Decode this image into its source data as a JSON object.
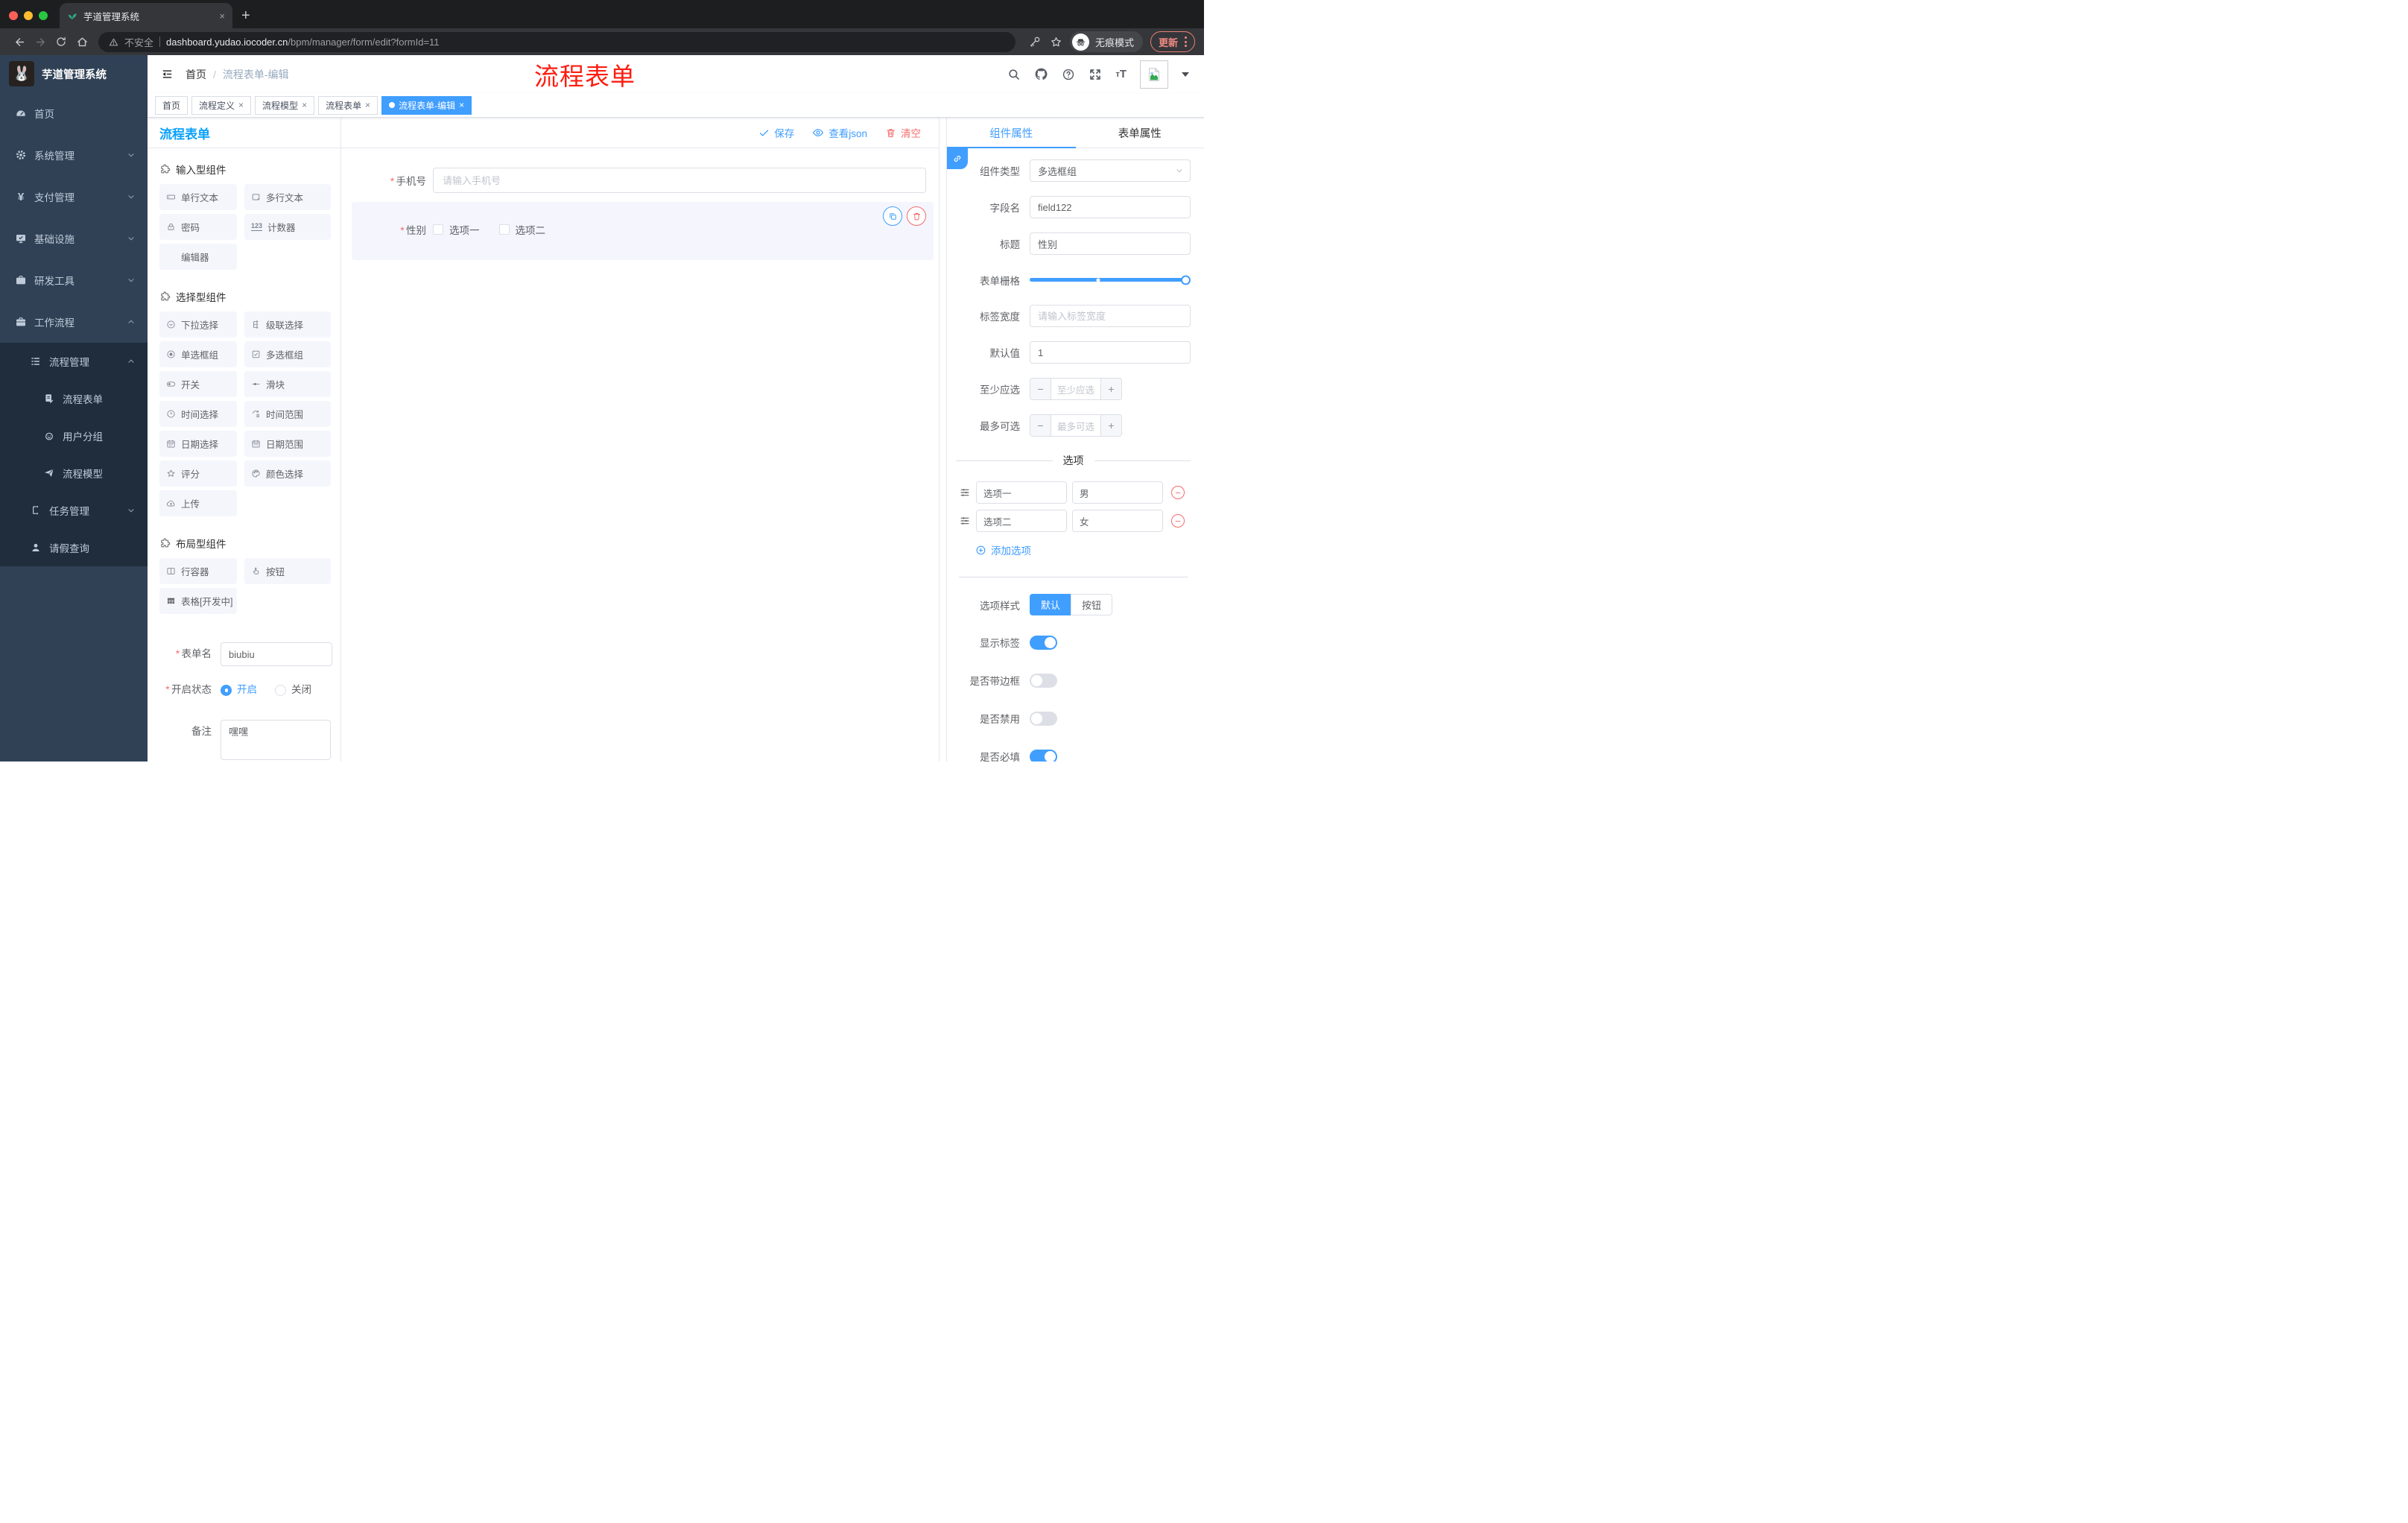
{
  "glyphs": {
    "close": "×",
    "plus": "+",
    "minus": "−",
    "yen": "¥",
    "required": "*",
    "font_size": "tT",
    "counter": "123"
  },
  "colors": {
    "accent": "#409eff",
    "danger": "#f56c6c",
    "panel_title_blue": "#0aa1fb",
    "annotation_red": "#fe1c10",
    "sidebar_bg": "#304156",
    "sidebar_sub_bg": "#1f2d3d",
    "chip_bg": "#f4f6fc",
    "selected_widget_bg": "#f4f5fd"
  },
  "browser": {
    "tab_title": "芋道管理系统",
    "security_label": "不安全",
    "url_domain": "dashboard.yudao.iocoder.cn",
    "url_path": "/bpm/manager/form/edit?formId=11",
    "incognito_label": "无痕模式",
    "update_label": "更新"
  },
  "header": {
    "breadcrumb_home": "首页",
    "breadcrumb_separator": "/",
    "breadcrumb_current": "流程表单-编辑",
    "annotation": "流程表单"
  },
  "sidebar": {
    "logo_title": "芋道管理系统",
    "items": {
      "home": "首页",
      "system": "系统管理",
      "payment": "支付管理",
      "infra": "基础设施",
      "dev": "研发工具",
      "workflow": "工作流程",
      "process_mgmt": "流程管理",
      "process_form": "流程表单",
      "user_group": "用户分组",
      "process_model": "流程模型",
      "task_mgmt": "任务管理",
      "leave_query": "请假查询"
    }
  },
  "tags": {
    "t0": "首页",
    "t1": "流程定义",
    "t2": "流程模型",
    "t3": "流程表单",
    "t4": "流程表单-编辑"
  },
  "left_panel": {
    "title": "流程表单",
    "sec_input": "输入型组件",
    "sec_select": "选择型组件",
    "sec_layout": "布局型组件",
    "items": {
      "single_text": "单行文本",
      "multi_text": "多行文本",
      "password": "密码",
      "counter": "计数器",
      "editor": "编辑器",
      "select": "下拉选择",
      "cascader": "级联选择",
      "radio_group": "单选框组",
      "checkbox_group": "多选框组",
      "switch": "开关",
      "slider": "滑块",
      "time": "时间选择",
      "time_range": "时间范围",
      "date": "日期选择",
      "date_range": "日期范围",
      "rate": "评分",
      "color": "颜色选择",
      "upload": "上传",
      "row": "行容器",
      "button": "按钮",
      "table": "表格[开发中]"
    },
    "form": {
      "name_label": "表单名",
      "name_value": "biubiu",
      "status_label": "开启状态",
      "status_on": "开启",
      "status_off": "关闭",
      "remark_label": "备注",
      "remark_value": "嘿嘿"
    }
  },
  "canvas": {
    "save": "保存",
    "view_json": "查看json",
    "clear": "清空",
    "phone": {
      "label": "手机号",
      "placeholder": "请输入手机号"
    },
    "gender": {
      "label": "性别",
      "opt1": "选项一",
      "opt2": "选项二"
    }
  },
  "right_panel": {
    "tab_component": "组件属性",
    "tab_form": "表单属性",
    "component_type_label": "组件类型",
    "component_type_value": "多选框组",
    "field_name_label": "字段名",
    "field_name_value": "field122",
    "title_label": "标题",
    "title_value": "性别",
    "grid_label": "表单栅格",
    "label_width_label": "标签宽度",
    "label_width_placeholder": "请输入标签宽度",
    "default_label": "默认值",
    "default_value": "1",
    "min_label": "至少应选",
    "min_placeholder": "至少应选",
    "max_label": "最多可选",
    "max_placeholder": "最多可选",
    "options_title": "选项",
    "options": [
      {
        "label": "选项一",
        "value": "男"
      },
      {
        "label": "选项二",
        "value": "女"
      }
    ],
    "add_option": "添加选项",
    "option_style_label": "选项样式",
    "style_default": "默认",
    "style_button": "按钮",
    "sw_show_label": "显示标签",
    "sw_border": "是否带边框",
    "sw_disabled": "是否禁用",
    "sw_required": "是否必填"
  }
}
